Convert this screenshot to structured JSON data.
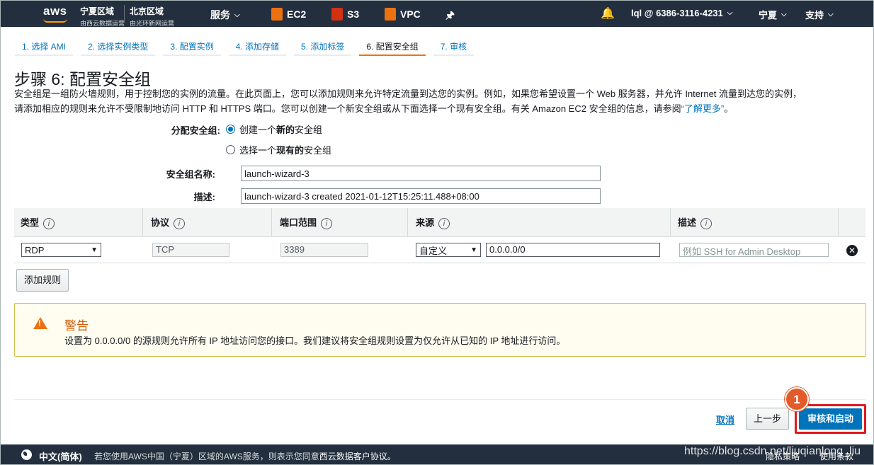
{
  "nav": {
    "logo": "aws",
    "region1": {
      "name": "宁夏区域",
      "sub": "由西云数据运营"
    },
    "region2": {
      "name": "北京区域",
      "sub": "由光环新网运营"
    },
    "services": "服务",
    "ec2": "EC2",
    "s3": "S3",
    "vpc": "VPC",
    "account": "lql @ 6386-3116-4231",
    "region": "宁夏",
    "support": "支持",
    "colors": {
      "bg": "#232f3e",
      "ec2": "#ec7211",
      "s3": "#d13212",
      "vpc": "#ec7211"
    }
  },
  "steps": [
    "1. 选择 AMI",
    "2. 选择实例类型",
    "3. 配置实例",
    "4. 添加存储",
    "5. 添加标签",
    "6. 配置安全组",
    "7. 审核"
  ],
  "page": {
    "title": "步骤 6: 配置安全组",
    "desc_line1": "安全组是一组防火墙规则，用于控制您的实例的流量。在此页面上，您可以添加规则来允许特定流量到达您的实例。例如，如果您希望设置一个 Web 服务器，并允许 Internet 流量到达您的实例，",
    "desc_line2": "请添加相应的规则来允许不受限制地访问 HTTP 和 HTTPS 端口。您可以创建一个新安全组或从下面选择一个现有安全组。有关 Amazon EC2 安全组的信息，请参阅",
    "desc_link": "“了解更多”",
    "desc_end": "。"
  },
  "form": {
    "assign_label": "分配安全组:",
    "radio_new_prefix": "创建一个",
    "radio_new_bold": "新的",
    "radio_new_suffix": "安全组",
    "radio_existing_prefix": "选择一个",
    "radio_existing_bold": "现有的",
    "radio_existing_suffix": "安全组",
    "name_label": "安全组名称:",
    "name_value": "launch-wizard-3",
    "desc_label": "描述:",
    "desc_value": "launch-wizard-3 created 2021-01-12T15:25:11.488+08:00"
  },
  "table": {
    "headers": [
      "类型",
      "协议",
      "端口范围",
      "来源",
      "描述"
    ],
    "row": {
      "type": "RDP",
      "protocol": "TCP",
      "port": "3389",
      "source_mode": "自定义",
      "source_cidr": "0.0.0.0/0",
      "desc_placeholder": "例如 SSH for Admin Desktop"
    },
    "add_rule": "添加规则"
  },
  "warning": {
    "title": "警告",
    "text": "设置为 0.0.0.0/0 的源规则允许所有 IP 地址访问您的接口。我们建议将安全组规则设置为仅允许从已知的 IP 地址进行访问。"
  },
  "actions": {
    "cancel": "取消",
    "previous": "上一步",
    "review_launch": "审核和启动",
    "badge": "1"
  },
  "footer": {
    "lang": "中文(简体)",
    "note_prefix": "若您使用AWS中国（宁夏）区域的AWS服务，则表示您同意",
    "note_link": "西云数据客户协议。",
    "privacy": "隐私策略",
    "terms": "使用条款",
    "watermark": "https://blog.csdn.net/liuqianlong_liu"
  }
}
